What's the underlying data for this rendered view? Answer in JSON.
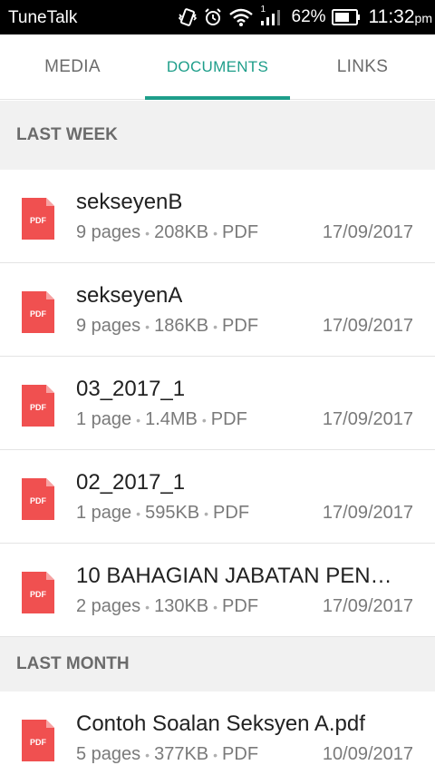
{
  "status_bar": {
    "carrier": "TuneTalk",
    "signal_label": "1",
    "battery_percent": "62%",
    "time": "11:32",
    "ampm": "pm"
  },
  "tabs": [
    {
      "label": "MEDIA",
      "active": false
    },
    {
      "label": "DOCUMENTS",
      "active": true
    },
    {
      "label": "LINKS",
      "active": false
    }
  ],
  "sections": [
    {
      "title": "LAST WEEK",
      "items": [
        {
          "name": "sekseyenB",
          "pages": "9 pages",
          "size": "208KB",
          "type": "PDF",
          "date": "17/09/2017",
          "icon": "pdf-file-icon",
          "icon_label": "PDF"
        },
        {
          "name": "sekseyenA",
          "pages": "9 pages",
          "size": "186KB",
          "type": "PDF",
          "date": "17/09/2017",
          "icon": "pdf-file-icon",
          "icon_label": "PDF"
        },
        {
          "name": "03_2017_1",
          "pages": "1 page",
          "size": "1.4MB",
          "type": "PDF",
          "date": "17/09/2017",
          "icon": "pdf-file-icon",
          "icon_label": "PDF"
        },
        {
          "name": "02_2017_1",
          "pages": "1 page",
          "size": "595KB",
          "type": "PDF",
          "date": "17/09/2017",
          "icon": "pdf-file-icon",
          "icon_label": "PDF"
        },
        {
          "name": "10 BAHAGIAN JABATAN PEN…",
          "pages": "2 pages",
          "size": "130KB",
          "type": "PDF",
          "date": "17/09/2017",
          "icon": "pdf-file-icon",
          "icon_label": "PDF"
        }
      ]
    },
    {
      "title": "LAST MONTH",
      "items": [
        {
          "name": "Contoh Soalan Seksyen A.pdf",
          "pages": "5 pages",
          "size": "377KB",
          "type": "PDF",
          "date": "10/09/2017",
          "icon": "pdf-file-icon",
          "icon_label": "PDF"
        }
      ]
    }
  ],
  "colors": {
    "accent": "#1e9e8a",
    "pdf_red": "#f05050",
    "section_bg": "#f1f1f1"
  }
}
